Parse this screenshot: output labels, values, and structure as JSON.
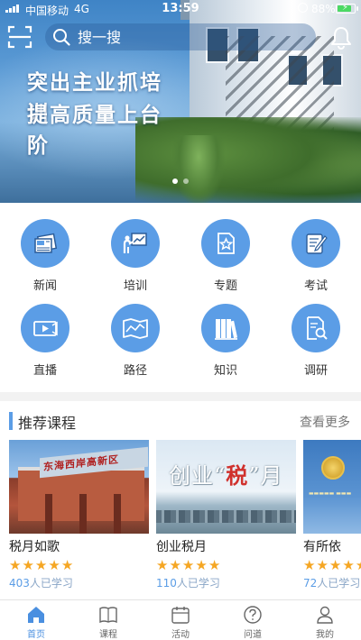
{
  "status_bar": {
    "carrier": "中国移动",
    "network": "4G",
    "time": "13:59",
    "battery_percent": "88%",
    "battery_level": 0.88,
    "battery_color": "#4cd964"
  },
  "header": {
    "search_placeholder": "搜一搜",
    "scan_icon": "scan-icon",
    "bell_icon": "bell-icon"
  },
  "banner": {
    "line1": "突出主业抓培训",
    "line2": "提高质量上台阶",
    "slide_count": 2,
    "active_slide": 1
  },
  "categories": [
    {
      "label": "新闻",
      "icon": "newspaper-icon"
    },
    {
      "label": "培训",
      "icon": "presentation-icon"
    },
    {
      "label": "专题",
      "icon": "star-document-icon"
    },
    {
      "label": "考试",
      "icon": "exam-pen-icon"
    },
    {
      "label": "直播",
      "icon": "video-camera-icon"
    },
    {
      "label": "路径",
      "icon": "map-icon"
    },
    {
      "label": "知识",
      "icon": "books-icon"
    },
    {
      "label": "调研",
      "icon": "survey-search-icon"
    }
  ],
  "recommended": {
    "title": "推荐课程",
    "more": "查看更多",
    "courses": [
      {
        "title": "税月如歌",
        "rating": 5,
        "count": "403",
        "suffix": "人已学习",
        "thumb_text": "东海西岸高新区"
      },
      {
        "title": "创业税月",
        "rating": 5,
        "count": "110",
        "suffix": "人已学习",
        "thumb_text": "创业“税”月"
      },
      {
        "title": "有所依",
        "rating": 5,
        "count": "72",
        "suffix": "人已学习",
        "thumb_text": ""
      }
    ]
  },
  "tabs": [
    {
      "label": "首页",
      "icon": "home-icon",
      "active": true
    },
    {
      "label": "课程",
      "icon": "book-icon",
      "active": false
    },
    {
      "label": "活动",
      "icon": "calendar-icon",
      "active": false
    },
    {
      "label": "问道",
      "icon": "question-icon",
      "active": false
    },
    {
      "label": "我的",
      "icon": "user-icon",
      "active": false
    }
  ],
  "colors": {
    "accent": "#5b9de6",
    "tab_active": "#4a8fe0",
    "star": "#f5a623"
  }
}
